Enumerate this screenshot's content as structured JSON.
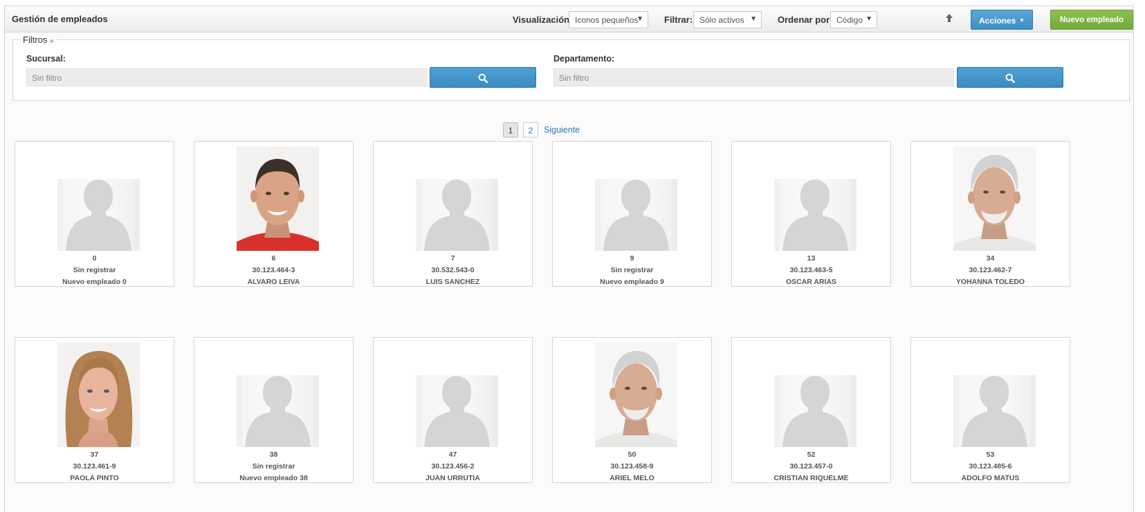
{
  "header": {
    "title": "Gestión de empleados",
    "visualizacion_label": "Visualización:",
    "visualizacion_value": "Iconos pequeños",
    "filtrar_label": "Filtrar:",
    "filtrar_value": "Sólo activos",
    "ordenar_label": "Ordenar por:",
    "ordenar_value": "Código",
    "sort_icon": "arrow-up-icon",
    "acciones_label": "Acciones",
    "nuevo_label": "Nuevo empleado",
    "colors": {
      "acciones": "#4a9bd0",
      "nuevo": "#7fb743"
    }
  },
  "filters": {
    "legend": "Filtros",
    "sucursal_label": "Sucursal:",
    "sucursal_placeholder": "Sin filtro",
    "departamento_label": "Departamento:",
    "departamento_placeholder": "Sin filtro",
    "search_icon": "search-icon"
  },
  "pagination": {
    "page1": "1",
    "page2": "2",
    "next": "Siguiente",
    "current": 1
  },
  "employees": [
    {
      "code": "0",
      "rut": "Sin registrar",
      "name": "Nuevo empleado 0",
      "photo": "placeholder"
    },
    {
      "code": "6",
      "rut": "30.123.464-3",
      "name": "ALVARO LEIVA",
      "photo": "man-young"
    },
    {
      "code": "7",
      "rut": "30.532.543-0",
      "name": "LUIS SANCHEZ",
      "photo": "placeholder"
    },
    {
      "code": "9",
      "rut": "Sin registrar",
      "name": "Nuevo empleado 9",
      "photo": "placeholder"
    },
    {
      "code": "13",
      "rut": "30.123.463-5",
      "name": "OSCAR ARIAS",
      "photo": "placeholder"
    },
    {
      "code": "34",
      "rut": "30.123.462-7",
      "name": "YOHANNA TOLEDO",
      "photo": "man-old"
    },
    {
      "code": "37",
      "rut": "30.123.461-9",
      "name": "PAOLA PINTO",
      "photo": "woman"
    },
    {
      "code": "38",
      "rut": "Sin registrar",
      "name": "Nuevo empleado 38",
      "photo": "placeholder"
    },
    {
      "code": "47",
      "rut": "30.123.456-2",
      "name": "JUAN URRUTIA",
      "photo": "placeholder"
    },
    {
      "code": "50",
      "rut": "30.123.458-9",
      "name": "ARIEL MELO",
      "photo": "man-old"
    },
    {
      "code": "52",
      "rut": "30.123.457-0",
      "name": "CRISTIAN RIQUELME",
      "photo": "placeholder"
    },
    {
      "code": "53",
      "rut": "30.123.485-6",
      "name": "ADOLFO MATUS",
      "photo": "placeholder"
    }
  ]
}
